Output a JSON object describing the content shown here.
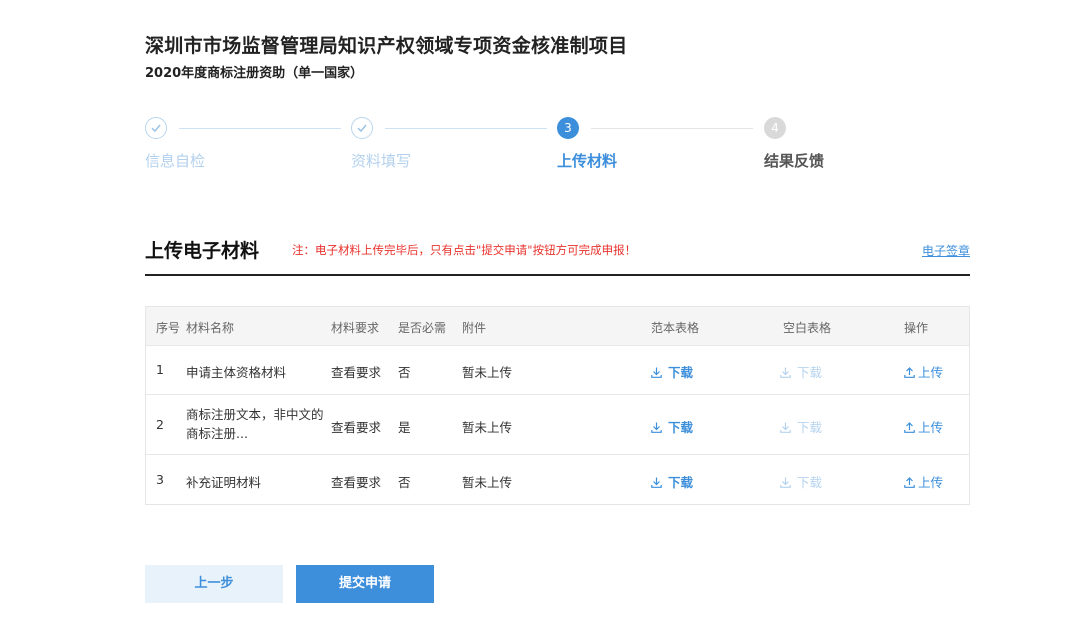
{
  "header": {
    "title": "深圳市市场监督管理局知识产权领域专项资金核准制项目",
    "subtitle": "2020年度商标注册资助（单一国家）"
  },
  "steps": [
    {
      "label": "信息自检",
      "number": "",
      "status": "done"
    },
    {
      "label": "资料填写",
      "number": "",
      "status": "done"
    },
    {
      "label": "上传材料",
      "number": "3",
      "status": "active"
    },
    {
      "label": "结果反馈",
      "number": "4",
      "status": "todo"
    }
  ],
  "section": {
    "title": "上传电子材料",
    "note": "注：电子材料上传完毕后，只有点击\"提交申请\"按钮方可完成申报！",
    "link": "电子签章"
  },
  "table": {
    "headers": {
      "no": "序号",
      "name": "材料名称",
      "req": "材料要求",
      "must": "是否必需",
      "att": "附件",
      "tpl": "范本表格",
      "blank": "空白表格",
      "op": "操作"
    },
    "rows": [
      {
        "no": "1",
        "name": "申请主体资格材料",
        "req": "查看要求",
        "must": "否",
        "att": "暂未上传",
        "tpl": "下载",
        "blank": "下载",
        "op": "上传"
      },
      {
        "no": "2",
        "name": "商标注册文本，非中文的商标注册...",
        "req": "查看要求",
        "must": "是",
        "att": "暂未上传",
        "tpl": "下载",
        "blank": "下载",
        "op": "上传"
      },
      {
        "no": "3",
        "name": "补充证明材料",
        "req": "查看要求",
        "must": "否",
        "att": "暂未上传",
        "tpl": "下载",
        "blank": "下载",
        "op": "上传"
      }
    ]
  },
  "buttons": {
    "prev": "上一步",
    "submit": "提交申请"
  },
  "colors": {
    "accent": "#3d8fdb",
    "warning": "#e8322d",
    "disabled": "#b5d3ef"
  }
}
